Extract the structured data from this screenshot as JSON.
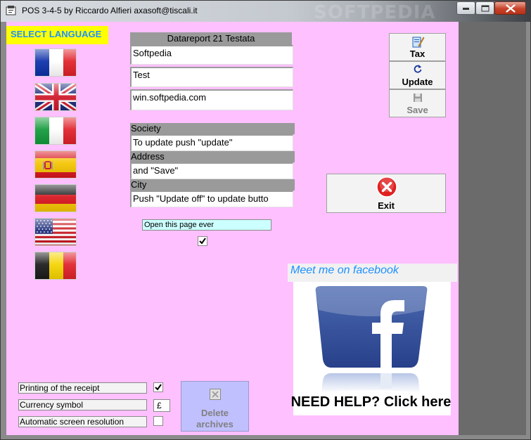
{
  "window": {
    "title": "POS 3-4-5 by Riccardo Alfieri axasoft@tiscali.it",
    "watermark": "SOFTPEDIA"
  },
  "language": {
    "label": "SELECT LANGUAGE",
    "flags": [
      "france-flag",
      "uk-flag",
      "italy-flag",
      "spain-flag",
      "germany-flag",
      "usa-flag",
      "belgium-flag"
    ]
  },
  "datareport": {
    "header": "Datareport 21 Testata",
    "line1": "Softpedia",
    "line2": "Test",
    "line3": "win.softpedia.com"
  },
  "company": {
    "society_label": "Society",
    "society_value": "To update push \"update\"",
    "address_label": "Address",
    "address_value": "and \"Save\"",
    "city_label": "City",
    "city_value": "Push \"Update off\" to update butto"
  },
  "open_page": {
    "label": "Open this page ever",
    "checked": true
  },
  "buttons": {
    "tax": "Tax",
    "update": "Update",
    "save": "Save",
    "exit": "Exit",
    "delete_archives_line1": "Delete",
    "delete_archives_line2": "archives"
  },
  "facebook": {
    "title": "Meet me on facebook",
    "need_help": "NEED HELP? Click here"
  },
  "options": {
    "receipt_label": "Printing of the receipt",
    "receipt_checked": true,
    "currency_label": "Currency symbol",
    "currency_value": "£",
    "resolution_label": "Automatic screen resolution",
    "resolution_checked": false
  },
  "colors": {
    "client_bg": "#ffc0ff",
    "select_lang_bg": "#ffff00",
    "select_lang_text": "#1e90ff",
    "facebook_blue": "#3b5998",
    "exit_red": "#e02020",
    "open_box_bg": "#ccffff",
    "delete_bg": "#c0c0ff"
  }
}
